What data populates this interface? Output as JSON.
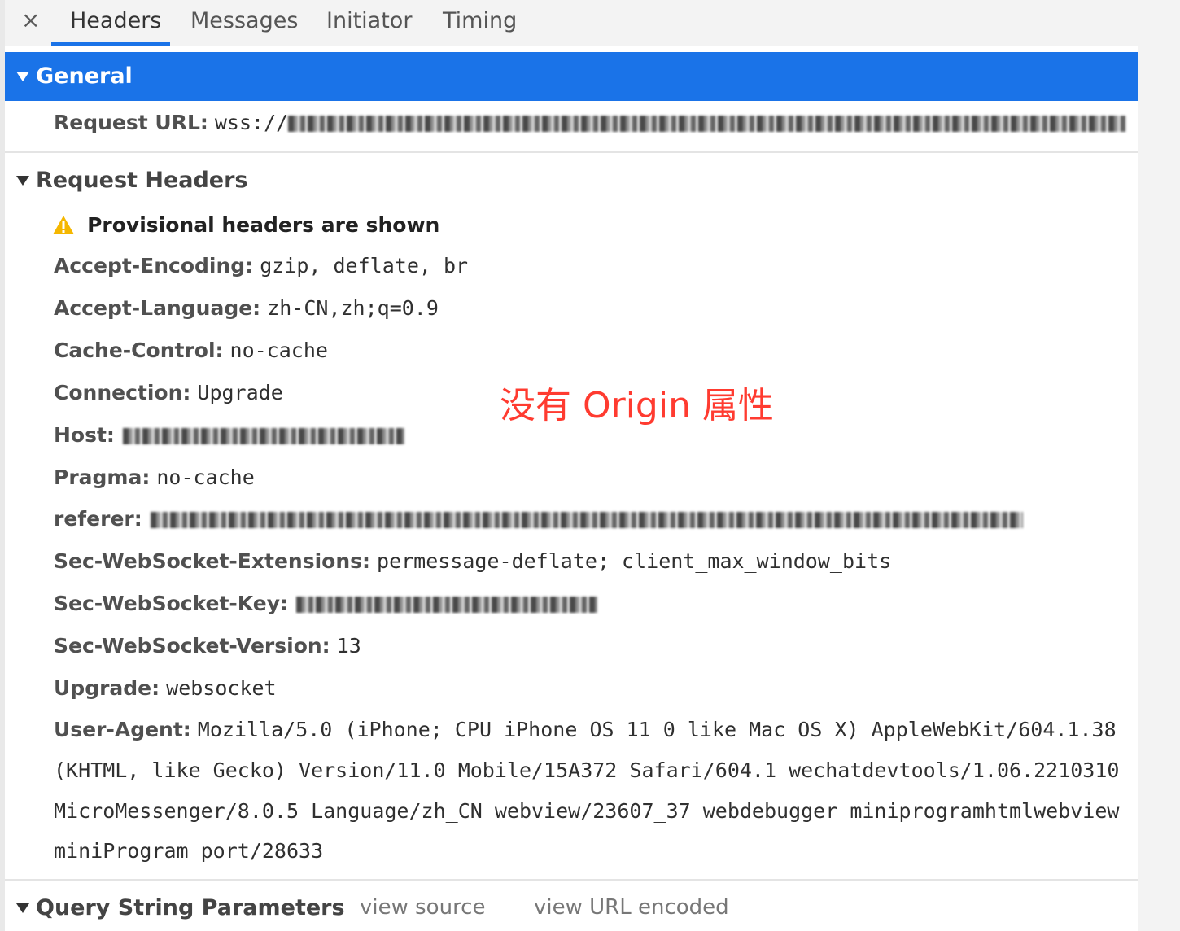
{
  "tabs": {
    "close_glyph": "×",
    "items": [
      {
        "label": "Headers",
        "active": true
      },
      {
        "label": "Messages",
        "active": false
      },
      {
        "label": "Initiator",
        "active": false
      },
      {
        "label": "Timing",
        "active": false
      }
    ]
  },
  "general": {
    "title": "General",
    "request_url_key": "Request URL:",
    "request_url_prefix": "wss://"
  },
  "request_headers": {
    "title": "Request Headers",
    "provisional_warning": "Provisional headers are shown",
    "rows": {
      "accept_encoding": {
        "key": "Accept-Encoding:",
        "value": "gzip, deflate, br"
      },
      "accept_language": {
        "key": "Accept-Language:",
        "value": "zh-CN,zh;q=0.9"
      },
      "cache_control": {
        "key": "Cache-Control:",
        "value": "no-cache"
      },
      "connection": {
        "key": "Connection:",
        "value": "Upgrade"
      },
      "host": {
        "key": "Host:"
      },
      "pragma": {
        "key": "Pragma:",
        "value": "no-cache"
      },
      "referer": {
        "key": "referer:"
      },
      "ws_extensions": {
        "key": "Sec-WebSocket-Extensions:",
        "value": "permessage-deflate; client_max_window_bits"
      },
      "ws_key": {
        "key": "Sec-WebSocket-Key:"
      },
      "ws_version": {
        "key": "Sec-WebSocket-Version:",
        "value": "13"
      },
      "upgrade": {
        "key": "Upgrade:",
        "value": "websocket"
      },
      "user_agent": {
        "key": "User-Agent:",
        "line1": "Mozilla/5.0 (iPhone; CPU iPhone OS 11_0 like Mac OS X) AppleWebKit/604.1.38",
        "line2": "(KHTML, like Gecko) Version/11.0 Mobile/15A372 Safari/604.1 wechatdevtools/1.06.2210310",
        "line3": "MicroMessenger/8.0.5 Language/zh_CN webview/23607_37 webdebugger miniprogramhtmlwebview",
        "line4": "miniProgram port/28633"
      }
    }
  },
  "annotation": "没有 Origin 属性",
  "query_string": {
    "title": "Query String Parameters",
    "view_source": "view source",
    "view_url_encoded": "view URL encoded"
  },
  "colors": {
    "accent": "#1a73e8",
    "annotation": "#ff3b30",
    "warning": "#f5b700"
  },
  "icons": {
    "close": "close-icon",
    "expand": "triangle-down-icon",
    "warning": "warning-icon"
  }
}
